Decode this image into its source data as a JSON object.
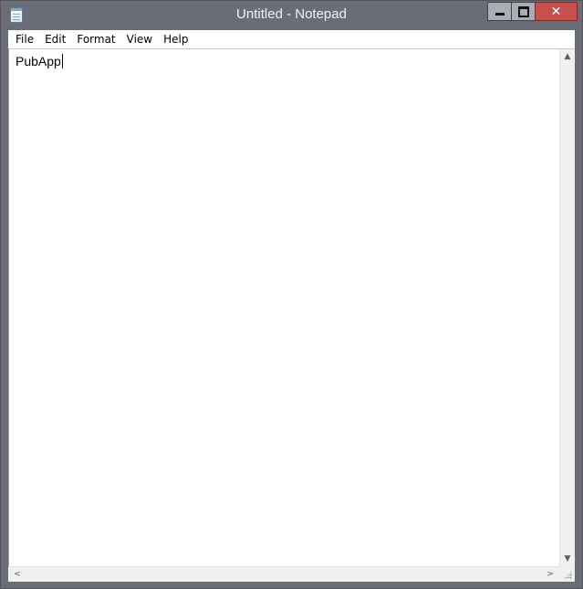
{
  "window": {
    "title": "Untitled - Notepad",
    "close_symbol": "✕"
  },
  "menu": {
    "items": [
      {
        "label": "File"
      },
      {
        "label": "Edit"
      },
      {
        "label": "Format"
      },
      {
        "label": "View"
      },
      {
        "label": "Help"
      }
    ]
  },
  "editor": {
    "text": "PubApp"
  },
  "scrollbars": {
    "up_arrow": "▲",
    "down_arrow": "▼",
    "left_arrow": "<",
    "right_arrow": ">"
  },
  "icons": {
    "app": "notepad-icon",
    "minimize": "minimize-icon",
    "maximize": "maximize-icon",
    "close": "close-icon"
  },
  "colors": {
    "titlebar": "#6a6d75",
    "close_button": "#c7504d"
  }
}
